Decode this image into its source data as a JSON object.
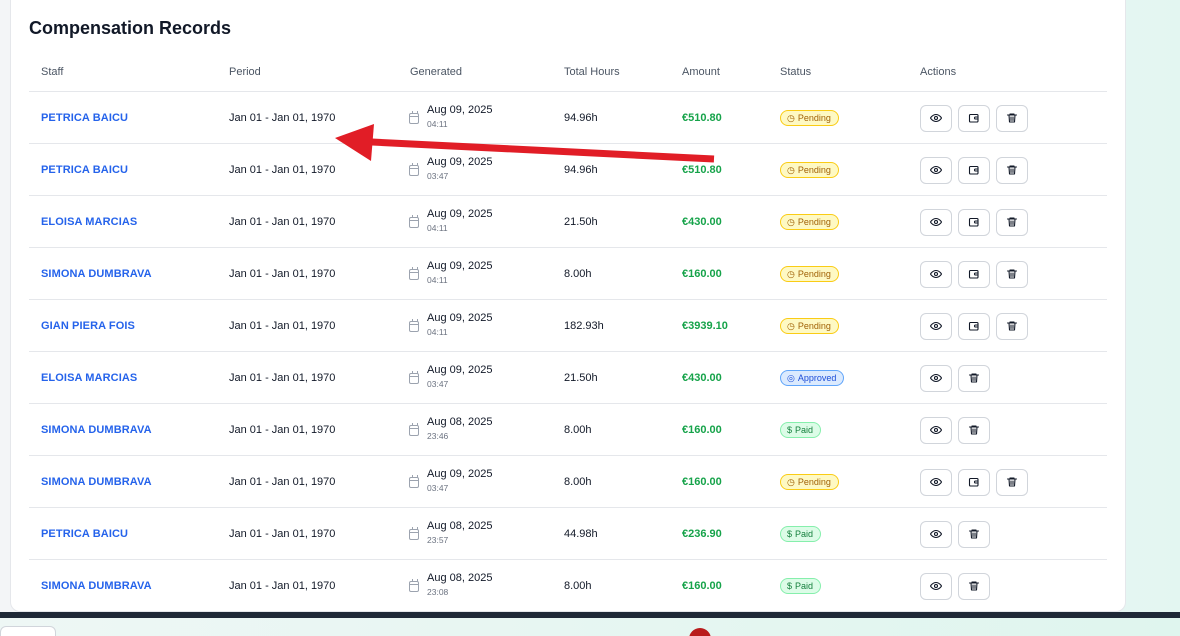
{
  "card": {
    "title": "Compensation Records"
  },
  "columns": [
    "Staff",
    "Period",
    "Generated",
    "Total Hours",
    "Amount",
    "Status",
    "Actions"
  ],
  "status_colors": {
    "pending": "#a16207",
    "approved": "#1d4ed8",
    "paid": "#15803d",
    "amount": "#16a34a",
    "staff_link": "#2563eb"
  },
  "icons": {
    "calendar": "calendar-icon",
    "view": "eye-icon",
    "pay": "wallet-icon",
    "delete": "trash-icon",
    "pending": "clock-icon",
    "approved": "check-circle-icon",
    "paid": "dollar-icon"
  },
  "annotation": {
    "type": "red-arrow",
    "color": "#e11d26"
  },
  "rows": [
    {
      "staff": "PETRICA BAICU",
      "period": "Jan 01 - Jan 01, 1970",
      "gen_date": "Aug 09, 2025",
      "gen_time": "04:11",
      "hours": "94.96h",
      "amount": "€510.80",
      "status": "Pending",
      "kind": "pending",
      "pay": true
    },
    {
      "staff": "PETRICA BAICU",
      "period": "Jan 01 - Jan 01, 1970",
      "gen_date": "Aug 09, 2025",
      "gen_time": "03:47",
      "hours": "94.96h",
      "amount": "€510.80",
      "status": "Pending",
      "kind": "pending",
      "pay": true
    },
    {
      "staff": "ELOISA MARCIAS",
      "period": "Jan 01 - Jan 01, 1970",
      "gen_date": "Aug 09, 2025",
      "gen_time": "04:11",
      "hours": "21.50h",
      "amount": "€430.00",
      "status": "Pending",
      "kind": "pending",
      "pay": true
    },
    {
      "staff": "SIMONA DUMBRAVA",
      "period": "Jan 01 - Jan 01, 1970",
      "gen_date": "Aug 09, 2025",
      "gen_time": "04:11",
      "hours": "8.00h",
      "amount": "€160.00",
      "status": "Pending",
      "kind": "pending",
      "pay": true
    },
    {
      "staff": "GIAN PIERA FOIS",
      "period": "Jan 01 - Jan 01, 1970",
      "gen_date": "Aug 09, 2025",
      "gen_time": "04:11",
      "hours": "182.93h",
      "amount": "€3939.10",
      "status": "Pending",
      "kind": "pending",
      "pay": true
    },
    {
      "staff": "ELOISA MARCIAS",
      "period": "Jan 01 - Jan 01, 1970",
      "gen_date": "Aug 09, 2025",
      "gen_time": "03:47",
      "hours": "21.50h",
      "amount": "€430.00",
      "status": "Approved",
      "kind": "approved",
      "pay": false
    },
    {
      "staff": "SIMONA DUMBRAVA",
      "period": "Jan 01 - Jan 01, 1970",
      "gen_date": "Aug 08, 2025",
      "gen_time": "23:46",
      "hours": "8.00h",
      "amount": "€160.00",
      "status": "Paid",
      "kind": "paid",
      "pay": false
    },
    {
      "staff": "SIMONA DUMBRAVA",
      "period": "Jan 01 - Jan 01, 1970",
      "gen_date": "Aug 09, 2025",
      "gen_time": "03:47",
      "hours": "8.00h",
      "amount": "€160.00",
      "status": "Pending",
      "kind": "pending",
      "pay": true
    },
    {
      "staff": "PETRICA BAICU",
      "period": "Jan 01 - Jan 01, 1970",
      "gen_date": "Aug 08, 2025",
      "gen_time": "23:57",
      "hours": "44.98h",
      "amount": "€236.90",
      "status": "Paid",
      "kind": "paid",
      "pay": false
    },
    {
      "staff": "SIMONA DUMBRAVA",
      "period": "Jan 01 - Jan 01, 1970",
      "gen_date": "Aug 08, 2025",
      "gen_time": "23:08",
      "hours": "8.00h",
      "amount": "€160.00",
      "status": "Paid",
      "kind": "paid",
      "pay": false
    }
  ]
}
